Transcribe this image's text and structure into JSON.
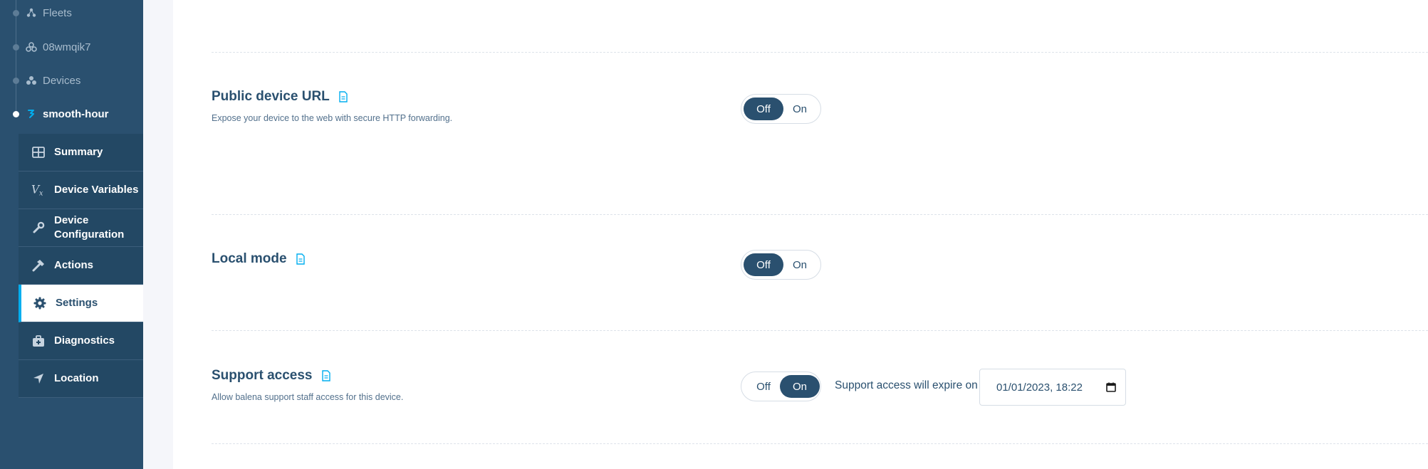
{
  "sidebar": {
    "breadcrumbs": [
      {
        "label": "Fleets",
        "icon": "fleets-icon"
      },
      {
        "label": "08wmqik7",
        "icon": "fleet-icon"
      },
      {
        "label": "Devices",
        "icon": "devices-icon"
      },
      {
        "label": "smooth-hour",
        "icon": "raspberry-pi-icon"
      }
    ],
    "nav": [
      {
        "label": "Summary",
        "icon": "summary-grid-icon"
      },
      {
        "label": "Device Variables",
        "icon": "variables-icon"
      },
      {
        "label": "Device Configuration",
        "icon": "wrench-icon"
      },
      {
        "label": "Actions",
        "icon": "hammer-icon"
      },
      {
        "label": "Settings",
        "icon": "gear-icon"
      },
      {
        "label": "Diagnostics",
        "icon": "medkit-icon"
      },
      {
        "label": "Location",
        "icon": "location-arrow-icon"
      }
    ],
    "selected_nav": "Settings"
  },
  "settings": {
    "public_url": {
      "title": "Public device URL",
      "description": "Expose your device to the web with secure HTTP forwarding.",
      "off_label": "Off",
      "on_label": "On",
      "value": "Off"
    },
    "local_mode": {
      "title": "Local mode",
      "off_label": "Off",
      "on_label": "On",
      "value": "Off"
    },
    "support_access": {
      "title": "Support access",
      "description": "Allow balena support staff access for this device.",
      "off_label": "Off",
      "on_label": "On",
      "value": "On",
      "expire_label": "Support access will expire on",
      "expire_value": "01/01/2023, 18:22"
    }
  },
  "colors": {
    "sidebar_bg": "#2a506f",
    "accent": "#00aeef",
    "toggle_selected": "#2a506f"
  }
}
